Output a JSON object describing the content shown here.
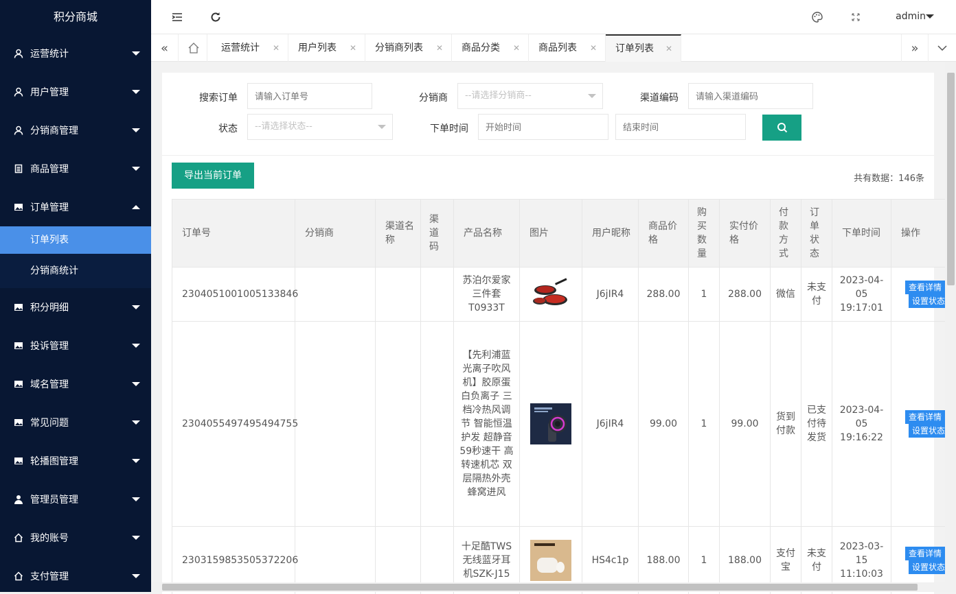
{
  "app": {
    "title": "积分商城"
  },
  "sidebar": {
    "items": [
      {
        "label": "运营统计",
        "icon": "user-icon"
      },
      {
        "label": "用户管理",
        "icon": "user-icon"
      },
      {
        "label": "分销商管理",
        "icon": "user-icon"
      },
      {
        "label": "商品管理",
        "icon": "doc-icon"
      },
      {
        "label": "订单管理",
        "icon": "image-icon",
        "expanded": true,
        "children": [
          {
            "label": "订单列表",
            "active": true
          },
          {
            "label": "分销商统计"
          }
        ]
      },
      {
        "label": "积分明细",
        "icon": "image-icon"
      },
      {
        "label": "投诉管理",
        "icon": "image-icon"
      },
      {
        "label": "域名管理",
        "icon": "image-icon"
      },
      {
        "label": "常见问题",
        "icon": "image-icon"
      },
      {
        "label": "轮播图管理",
        "icon": "image-icon"
      },
      {
        "label": "管理员管理",
        "icon": "person-icon"
      },
      {
        "label": "我的账号",
        "icon": "home-icon"
      },
      {
        "label": "支付管理",
        "icon": "home-icon"
      }
    ]
  },
  "header": {
    "user": "admin"
  },
  "tabs": [
    {
      "label": "运营统计"
    },
    {
      "label": "用户列表"
    },
    {
      "label": "分销商列表"
    },
    {
      "label": "商品分类"
    },
    {
      "label": "商品列表"
    },
    {
      "label": "订单列表",
      "active": true
    }
  ],
  "filters": {
    "order_label": "搜索订单",
    "order_placeholder": "请输入订单号",
    "dist_label": "分销商",
    "dist_placeholder": "--请选择分销商--",
    "channel_label": "渠道编码",
    "channel_placeholder": "请输入渠道编码",
    "status_label": "状态",
    "status_placeholder": "--请选择状态--",
    "time_label": "下单时间",
    "start_placeholder": "开始时间",
    "end_placeholder": "结束时间"
  },
  "toolbar": {
    "export_label": "导出当前订单",
    "total_label": "共有数据：",
    "total_value": "146条"
  },
  "table": {
    "headers": [
      "订单号",
      "分销商",
      "渠道名称",
      "渠道码",
      "产品名称",
      "图片",
      "用户昵称",
      "商品价格",
      "购买数量",
      "实付价格",
      "付款方式",
      "订单状态",
      "下单时间",
      "操作"
    ],
    "rows": [
      {
        "order_no": "2304051001005133846",
        "distributor": "",
        "channel_name": "",
        "channel_code": "",
        "product": "苏泊尔爱家三件套T0933T",
        "image": "pan-set-image",
        "nickname": "J6jIR4",
        "price": "288.00",
        "qty": "1",
        "paid": "288.00",
        "pay_method": "微信",
        "status": "未支付",
        "time": "2023-04-05 19:17:01",
        "op_detail": "查看详情",
        "op_status": "设置状态"
      },
      {
        "order_no": "2304055497495494755",
        "distributor": "",
        "channel_name": "",
        "channel_code": "",
        "product": "【先利浦蓝光离子吹风机】胶原蛋白负离子 三档冷热风调节 智能恒温护发 超静音 59秒速干 高转速机芯 双层隔热外壳 蜂窝进风",
        "image": "hair-dryer-image",
        "nickname": "J6jIR4",
        "price": "99.00",
        "qty": "1",
        "paid": "99.00",
        "pay_method": "货到付款",
        "status": "已支付待发货",
        "time": "2023-04-05 19:16:22",
        "op_detail": "查看详情",
        "op_status": "设置状态"
      },
      {
        "order_no": "2303159853505372206",
        "distributor": "",
        "channel_name": "",
        "channel_code": "",
        "product": "十足酷TWS无线蓝牙耳机SZK-J15",
        "image": "earbuds-image",
        "nickname": "HS4c1p",
        "price": "188.00",
        "qty": "1",
        "paid": "188.00",
        "pay_method": "支付宝",
        "status": "未支付",
        "time": "2023-03-15 11:10:03",
        "op_detail": "查看详情",
        "op_status": "设置状态"
      }
    ]
  }
}
